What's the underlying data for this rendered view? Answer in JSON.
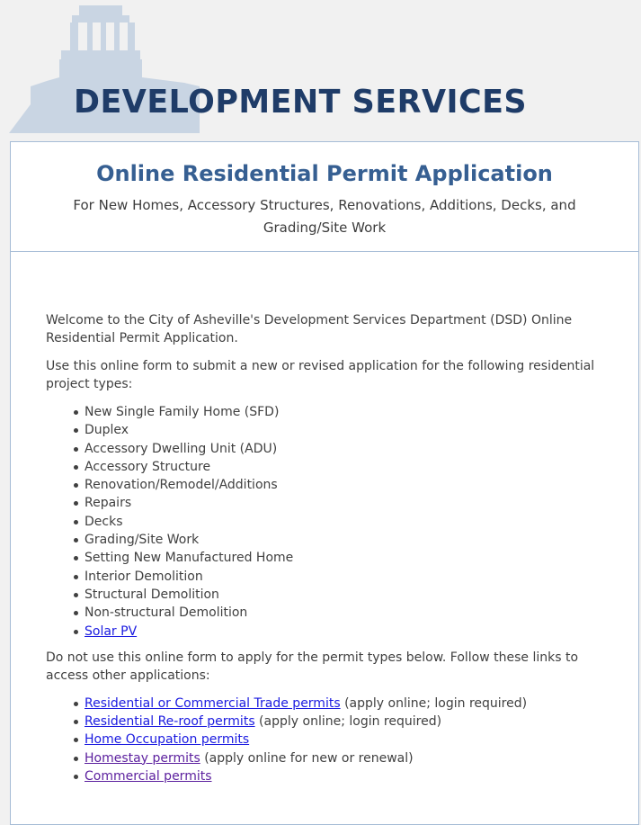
{
  "header": {
    "department": "DEVELOPMENT SERVICES"
  },
  "form": {
    "title": "Online Residential Permit Application",
    "subtitle": "For New Homes, Accessory Structures, Renovations, Additions, Decks, and Grading/Site Work",
    "intro_paragraph_1": "Welcome to the City of Asheville's Development Services Department (DSD) Online Residential Permit Application.",
    "intro_paragraph_2": "Use this online form to submit a new or revised application for the following residential project types:",
    "project_types": [
      "New Single Family Home (SFD)",
      "Duplex",
      "Accessory Dwelling Unit (ADU)",
      "Accessory Structure",
      "Renovation/Remodel/Additions",
      "Repairs",
      "Decks",
      "Grading/Site Work",
      "Setting New Manufactured Home",
      "Interior Demolition",
      "Structural Demolition",
      "Non-structural Demolition"
    ],
    "solar_link": "Solar PV",
    "other_paragraph": "Do not use this online form to apply for the permit types below. Follow these links to access other applications:",
    "other_permits": [
      {
        "link": "Residential or Commercial Trade permits",
        "note": " (apply online; login required)"
      },
      {
        "link": "Residential Re-roof permits",
        "note": " (apply online; login required)"
      },
      {
        "link": "Home Occupation permits",
        "note": ""
      },
      {
        "link": "Homestay permits",
        "note": " (apply online for new or renewal)"
      },
      {
        "link": "Commercial permits",
        "note": ""
      }
    ]
  },
  "colors": {
    "page_background": "#f1f1f1",
    "brand_navy": "#1f3c68",
    "title_blue": "#365f92",
    "logo_silhouette": "#c9d5e3",
    "link": "#1a1ae0",
    "visited_link": "#5b1f9e",
    "card_border": "#a6bcd6"
  },
  "icons": {
    "logo": "city-hall-building-icon"
  }
}
